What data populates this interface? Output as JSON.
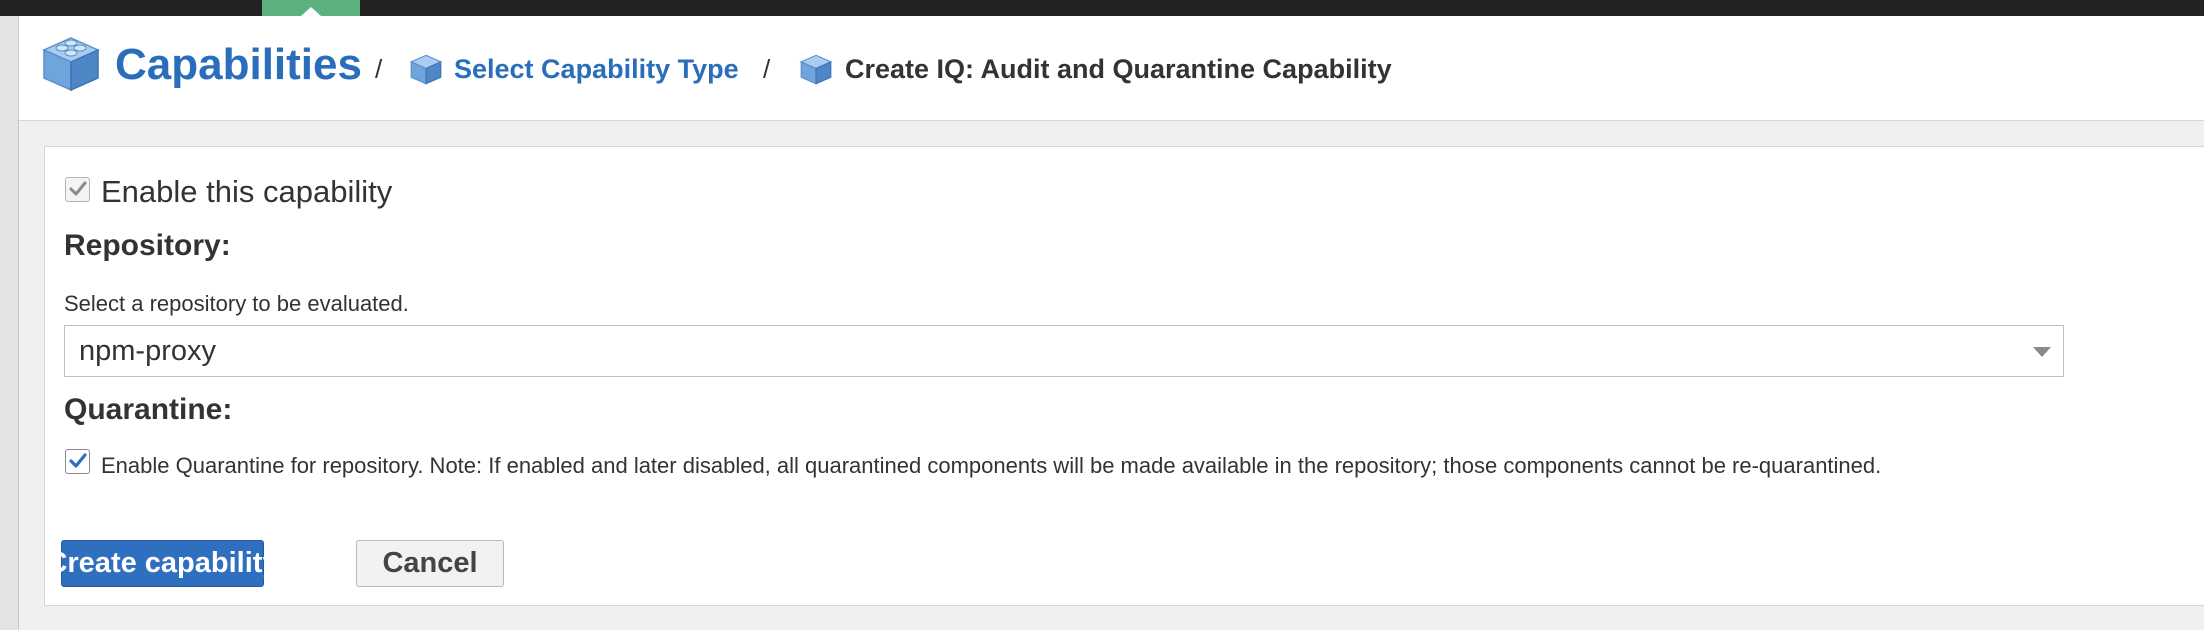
{
  "breadcrumb": {
    "main": "Capabilities",
    "separator": "/",
    "item2": "Select Capability Type",
    "item3": "Create IQ: Audit and Quarantine Capability",
    "icon": "cube-icon"
  },
  "form": {
    "enable_label": "Enable this capability",
    "enable_checked": true,
    "repository_title": "Repository:",
    "repository_help": "Select a repository to be evaluated.",
    "repository_value": "npm-proxy",
    "quarantine_title": "Quarantine:",
    "quarantine_label": "Enable Quarantine for repository. Note: If enabled and later disabled, all quarantined components will be made available in the repository; those components cannot be re-quarantined.",
    "quarantine_checked": true
  },
  "actions": {
    "create_label": "Create capability",
    "cancel_label": "Cancel"
  },
  "colors": {
    "accent": "#2a6ebb",
    "primary_button": "#2f6fbf",
    "active_tab": "#5cb27e",
    "topbar": "#232323"
  }
}
